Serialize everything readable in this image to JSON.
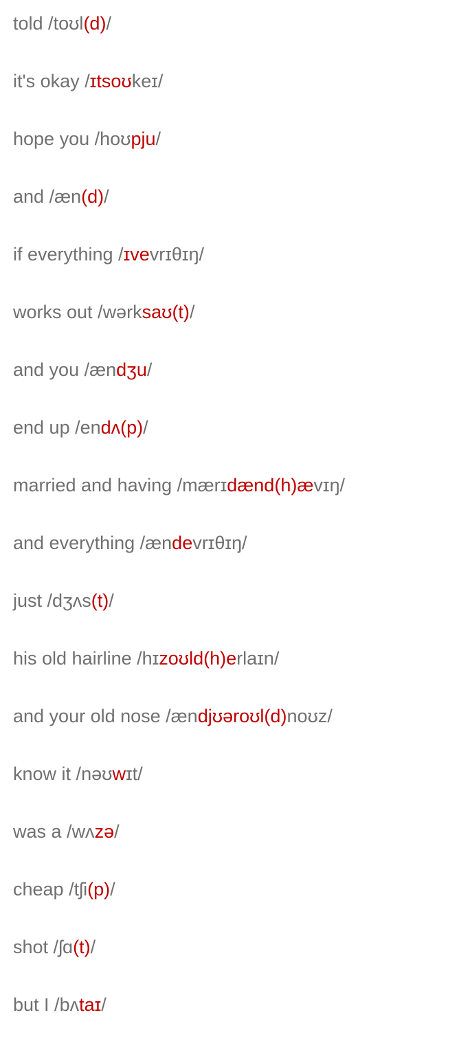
{
  "colors": {
    "text": "#707070",
    "highlight": "#c00000",
    "background": "#ffffff"
  },
  "entries": [
    {
      "phrase": "told",
      "ipa_pre": "toʊl",
      "ipa_hl": "(d)",
      "ipa_post": ""
    },
    {
      "phrase": "it's okay",
      "ipa_pre": "",
      "ipa_hl": "ɪtsoʊ",
      "ipa_post": "keɪ"
    },
    {
      "phrase": "hope you",
      "ipa_pre": "hoʊ",
      "ipa_hl": "pju",
      "ipa_post": ""
    },
    {
      "phrase": "and",
      "ipa_pre": "æn",
      "ipa_hl": "(d)",
      "ipa_post": ""
    },
    {
      "phrase": "if everything",
      "ipa_pre": "",
      "ipa_hl": "ɪve",
      "ipa_post": "vrɪθɪŋ"
    },
    {
      "phrase": "works out",
      "ipa_pre": "wərk",
      "ipa_hl": "saʊ(t)",
      "ipa_post": ""
    },
    {
      "phrase": "and you",
      "ipa_pre": "æn",
      "ipa_hl": "dʒu",
      "ipa_post": ""
    },
    {
      "phrase": "end up",
      "ipa_pre": "en",
      "ipa_hl": "dʌ(p)",
      "ipa_post": ""
    },
    {
      "phrase": "married and having",
      "ipa_pre": "mærɪ",
      "ipa_hl": "dænd(h)æ",
      "ipa_post": "vɪŋ"
    },
    {
      "phrase": "and everything",
      "ipa_pre": "æn",
      "ipa_hl": "de",
      "ipa_post": "vrɪθɪŋ"
    },
    {
      "phrase": "just",
      "ipa_pre": "dʒʌs",
      "ipa_hl": "(t)",
      "ipa_post": ""
    },
    {
      "phrase": "his old hairline",
      "ipa_pre": "hɪ",
      "ipa_hl": "zoʊld(h)e",
      "ipa_post": "rlaɪn"
    },
    {
      "phrase": "and your old nose",
      "ipa_pre": "æn",
      "ipa_hl": "djʊəroʊl(d)",
      "ipa_post": "noʊz"
    },
    {
      "phrase": "know it",
      "ipa_pre": "nəʊ",
      "ipa_hl": "w",
      "ipa_post": "ɪt"
    },
    {
      "phrase": "was a",
      "ipa_pre": "wʌ",
      "ipa_hl": "zə",
      "ipa_post": ""
    },
    {
      "phrase": "cheap",
      "ipa_pre": "tʃi",
      "ipa_hl": "(p)",
      "ipa_post": ""
    },
    {
      "phrase": "shot",
      "ipa_pre": "ʃɑ",
      "ipa_hl": "(t)",
      "ipa_post": ""
    },
    {
      "phrase": "but I",
      "ipa_pre": "bʌ",
      "ipa_hl": "taɪ",
      "ipa_post": ""
    }
  ]
}
